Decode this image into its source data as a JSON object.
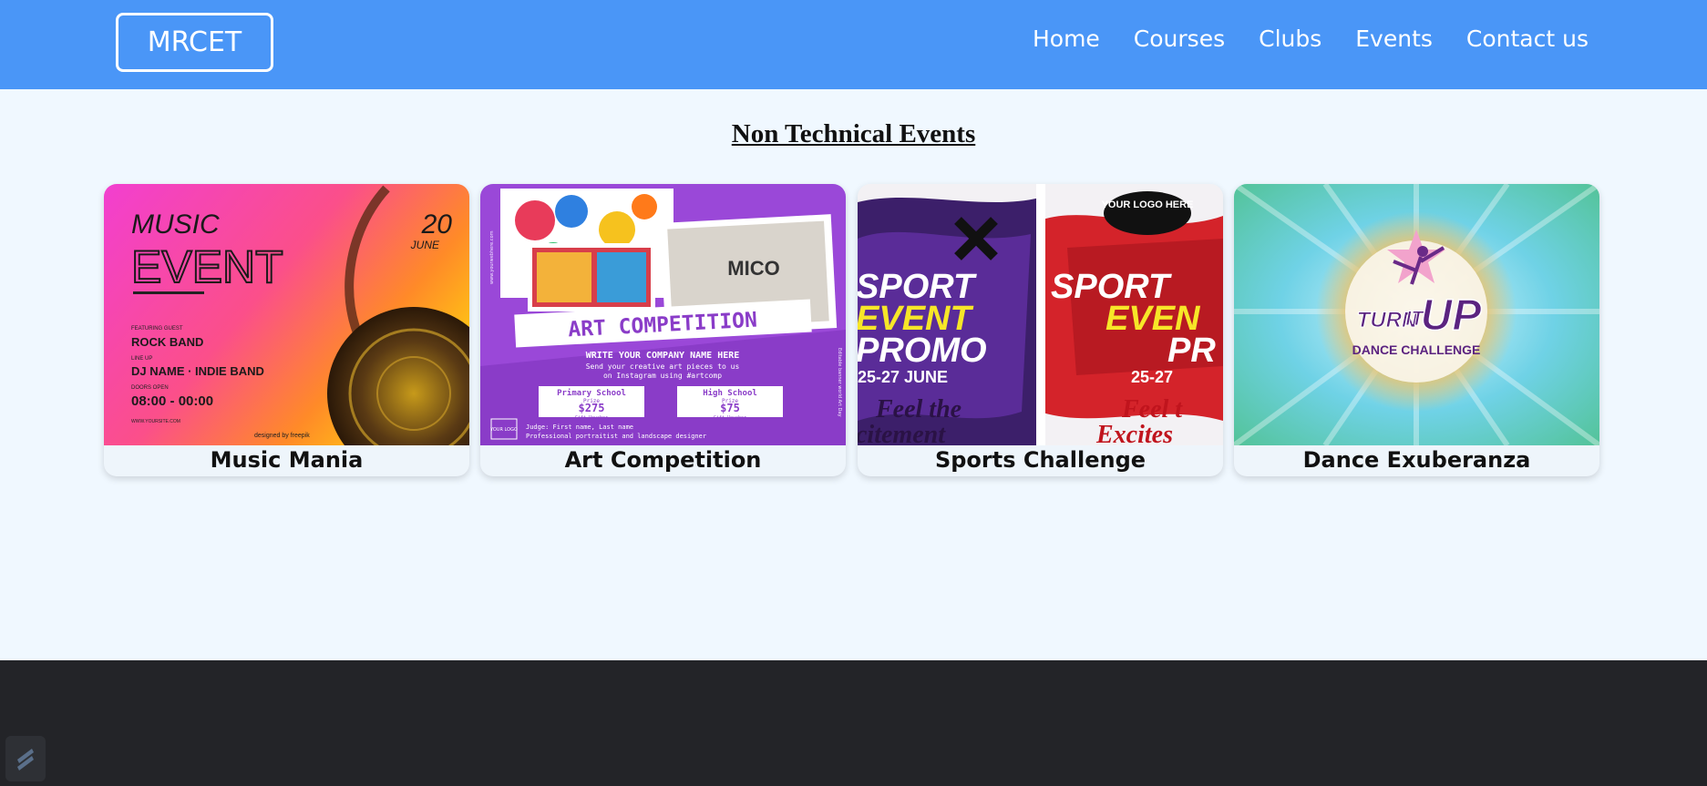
{
  "brand": "MRCET",
  "nav": [
    "Home",
    "Courses",
    "Clubs",
    "Events",
    "Contact us"
  ],
  "section_title": "Non Technical Events",
  "events": [
    {
      "title": "Music Mania",
      "poster": {
        "heading1": "MUSIC",
        "heading2": "EVENT",
        "date_day": "20",
        "date_month": "JUNE",
        "featuring_label": "FEATURING GUEST",
        "featuring": "ROCK BAND",
        "lineup_label": "LINE UP",
        "lineup": "DJ NAME · INDIE BAND",
        "doors_label": "DOORS OPEN",
        "time": "08:00 - 00:00",
        "website": "WWW.YOURSITE.COM",
        "credit": "designed by freepik"
      }
    },
    {
      "title": "Art Competition",
      "poster": {
        "banner": "ART COMPETITION",
        "company": "WRITE YOUR COMPANY NAME HERE",
        "line1": "Send your creative art pieces to us",
        "line2": "on Instagram using #artcomp",
        "prize1_label": "Primary School",
        "prize1_sub": "Prize",
        "prize1_amount": "$275",
        "prize1_note": "Gift Voucher",
        "prize2_label": "High School",
        "prize2_sub": "Prize",
        "prize2_amount": "$75",
        "prize2_note": "Gift Voucher",
        "judge": "Judge: First name, Last name",
        "judge_role": "Professional portraitist and landscape designer",
        "logo": "YOUR LOGO",
        "side_left": "www.yourwebhere.com",
        "side_right": "Editable banner world Art Day"
      }
    },
    {
      "title": "Sports Challenge",
      "poster": {
        "logo": "YOUR LOGO HERE",
        "left_line1": "SPORT",
        "left_line2": "EVENT",
        "left_line3": "PROMO",
        "left_date": "25-27 JUNE",
        "left_tag1": "Feel the",
        "left_tag2": "citement",
        "right_line1": "SPORT",
        "right_line2": "EVEN",
        "right_line3": "PR",
        "right_date": "25-27",
        "right_tag1": "Feel t",
        "right_tag2": "Excites"
      }
    },
    {
      "title": "Dance Exuberanza",
      "poster": {
        "logo_line1": "TURN",
        "logo_line2": "IT",
        "logo_line3": "UP",
        "subtitle": "DANCE CHALLENGE"
      }
    }
  ],
  "colors": {
    "navbar": "#4a96f7",
    "page_bg": "#f0f8ff",
    "footer": "#232428"
  }
}
